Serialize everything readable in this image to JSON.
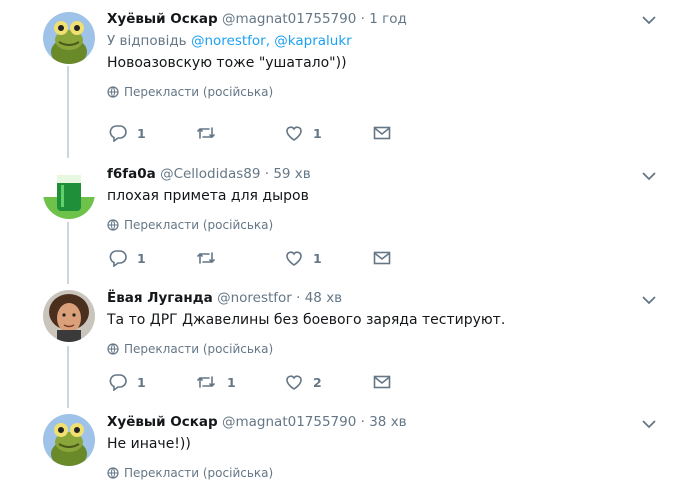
{
  "tweets": [
    {
      "name": "Хуёвый Оскар",
      "handle": "@magnat01755790",
      "separator": "·",
      "time": "1 год",
      "reply_prefix": "У відповідь",
      "reply_to": "@norestfor, @kapralukr",
      "text": "Новоазовскую тоже \"ушатало\"))",
      "translate": "Перекласти (російська)",
      "replies": "1",
      "retweets": "",
      "likes": "1"
    },
    {
      "name": "f6fa0a",
      "handle": "@Cellodidas89",
      "separator": "·",
      "time": "59 хв",
      "text": "плохая примета для дыров",
      "translate": "Перекласти (російська)",
      "replies": "1",
      "retweets": "",
      "likes": "1"
    },
    {
      "name": "Ёвая Луганда",
      "handle": "@norestfor",
      "separator": "·",
      "time": "48 хв",
      "text": "Та то ДРГ Джавелины без боевого заряда тестируют.",
      "translate": "Перекласти (російська)",
      "replies": "1",
      "retweets": "1",
      "likes": "2"
    },
    {
      "name": "Хуёвый Оскар",
      "handle": "@magnat01755790",
      "separator": "·",
      "time": "38 хв",
      "text": "Не иначе!))",
      "translate": "Перекласти (російська)"
    }
  ],
  "colors": {
    "link": "#1da1f2",
    "muted": "#657786",
    "thread_line": "#ccd6dd"
  }
}
